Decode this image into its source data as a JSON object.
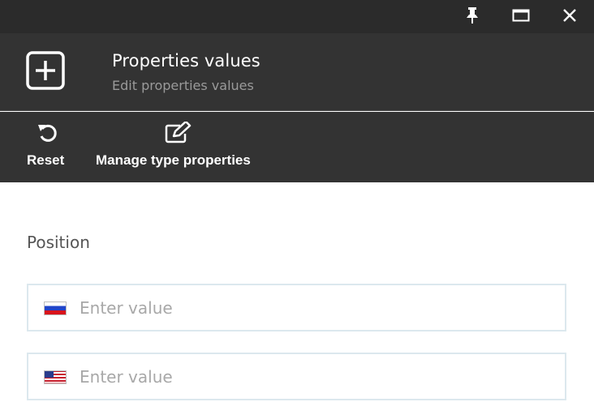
{
  "window_controls": {
    "icons": [
      "pin-icon",
      "maximize-icon",
      "close-icon"
    ]
  },
  "header": {
    "icon": "plus-square-icon",
    "title": "Properties values",
    "subtitle": "Edit properties values"
  },
  "toolbar": {
    "buttons": [
      {
        "icon": "reset-icon",
        "label": "Reset"
      },
      {
        "icon": "edit-icon",
        "label": "Manage type properties"
      }
    ]
  },
  "form": {
    "section_label": "Position",
    "fields": [
      {
        "language": "Russian",
        "flag": "russia-flag-icon",
        "value": "",
        "placeholder": "Enter value"
      },
      {
        "language": "English",
        "flag": "usa-flag-icon",
        "value": "",
        "placeholder": "Enter value"
      }
    ]
  },
  "colors": {
    "titlebar_bg": "#2b2b2b",
    "panel_bg": "#333333",
    "field_border": "#dce8ee",
    "placeholder": "#a8a8a8"
  }
}
